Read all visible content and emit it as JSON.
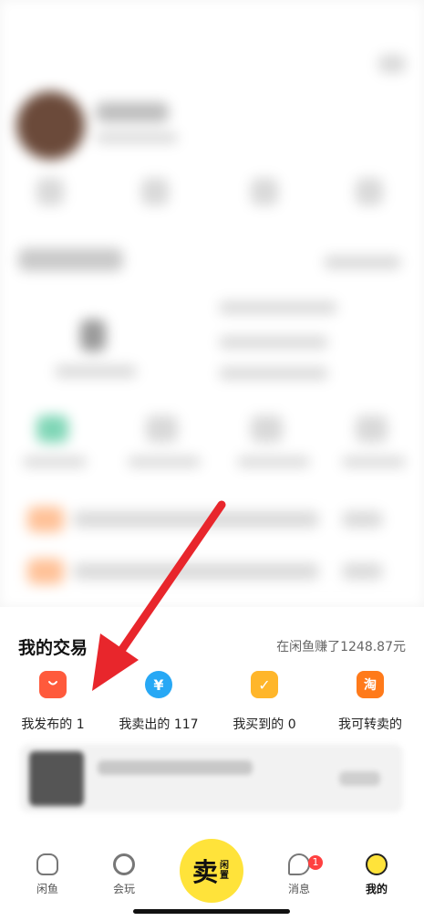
{
  "trade_section": {
    "title": "我的交易",
    "earnings": "在闲鱼赚了1248.87元",
    "items": [
      {
        "label": "我发布的 1",
        "icon": "bag-icon",
        "glyph": "",
        "color": "#ff5a3c"
      },
      {
        "label": "我卖出的 117",
        "icon": "yen-icon",
        "glyph": "¥",
        "color": "#27a8f5"
      },
      {
        "label": "我买到的 0",
        "icon": "checklist-icon",
        "glyph": "✓",
        "color": "#ffb62a"
      },
      {
        "label": "我可转卖的",
        "icon": "taobao-icon",
        "glyph": "淘",
        "color": "#ff7a1a"
      }
    ]
  },
  "tabbar": {
    "tabs": [
      {
        "label": "闲鱼",
        "icon": "home-icon"
      },
      {
        "label": "会玩",
        "icon": "play-icon"
      },
      {
        "label": "消息",
        "icon": "message-icon",
        "badge": "1"
      },
      {
        "label": "我的",
        "icon": "profile-icon"
      }
    ],
    "sell_main": "卖",
    "sell_sub": "闲置"
  },
  "colors": {
    "arrow": "#e8262c",
    "sell_button": "#ffe33a"
  }
}
